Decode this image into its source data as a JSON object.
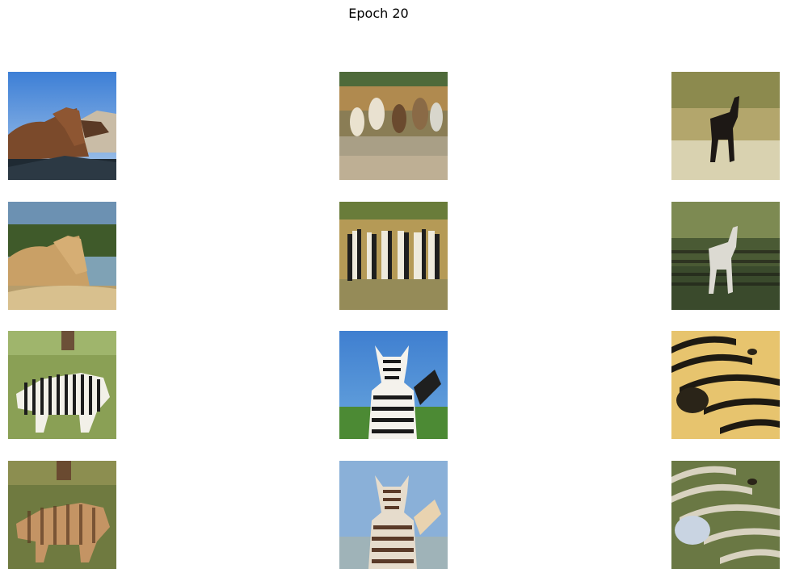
{
  "figure": {
    "title": "Epoch 20"
  },
  "grid": {
    "rows": [
      [
        {
          "subject": "brown-horse-photo"
        },
        {
          "subject": "horses-running-in-water-photo"
        },
        {
          "subject": "dark-horse-on-grass-photo"
        }
      ],
      [
        {
          "subject": "brown-horse-translated"
        },
        {
          "subject": "herd-zebra-translated"
        },
        {
          "subject": "white-horse-translated"
        }
      ],
      [
        {
          "subject": "zebras-in-field-photo"
        },
        {
          "subject": "zebra-front-blue-sky-photo"
        },
        {
          "subject": "zebra-closeup-photo"
        }
      ],
      [
        {
          "subject": "zebras-in-field-horse-translated"
        },
        {
          "subject": "zebra-front-translated"
        },
        {
          "subject": "zebra-closeup-translated"
        }
      ]
    ]
  }
}
